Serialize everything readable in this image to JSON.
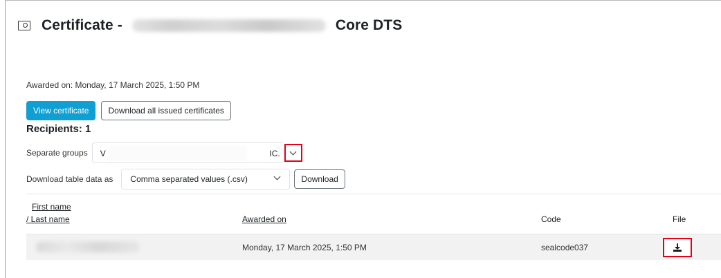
{
  "header": {
    "title_prefix": "Certificate -",
    "title_suffix": "Core DTS",
    "icon": "certificate-icon"
  },
  "awarded_text": "Awarded on: Monday, 17 March 2025, 1:50 PM",
  "buttons": {
    "view_certificate": "View certificate",
    "download_all": "Download all issued certificates"
  },
  "recipients": "Recipients: 1",
  "groups": {
    "label": "Separate groups",
    "value_start": "V",
    "value_end": "IC."
  },
  "download": {
    "label": "Download table data as",
    "selected": "Comma separated values (.csv)",
    "button": "Download"
  },
  "table": {
    "headers": {
      "first_name": "First name",
      "last_name": "/ Last name",
      "awarded_on": "Awarded on",
      "code": "Code",
      "file": "File"
    },
    "rows": [
      {
        "awarded_on": "Monday, 17 March 2025, 1:50 PM",
        "code": "sealcode037",
        "file_icon": "download-icon"
      }
    ]
  },
  "colors": {
    "primary": "#0f9fd3",
    "highlight": "#e0001a"
  }
}
